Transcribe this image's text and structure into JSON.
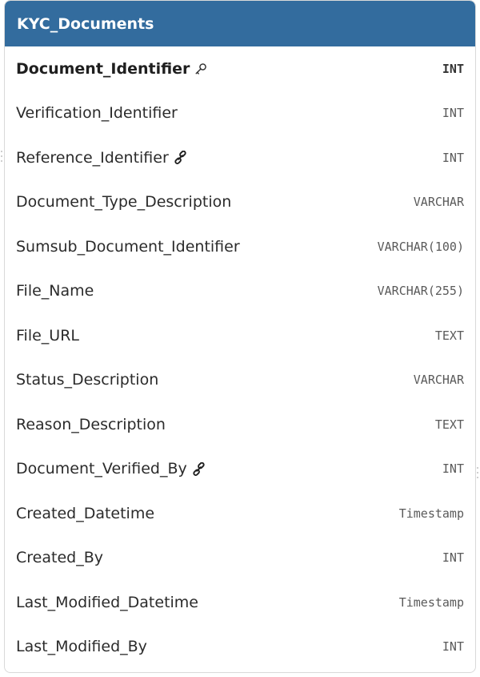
{
  "table": {
    "name": "KYC_Documents",
    "header_color": "#336c9e",
    "columns": [
      {
        "name": "Document_Identifier",
        "type": "INT",
        "icon": "key-icon",
        "primary_key": true
      },
      {
        "name": "Verification_Identifier",
        "type": "INT",
        "icon": "",
        "primary_key": false
      },
      {
        "name": "Reference_Identifier",
        "type": "INT",
        "icon": "link-icon",
        "primary_key": false
      },
      {
        "name": "Document_Type_Description",
        "type": "VARCHAR",
        "icon": "",
        "primary_key": false
      },
      {
        "name": "Sumsub_Document_Identifier",
        "type": "VARCHAR(100)",
        "icon": "",
        "primary_key": false
      },
      {
        "name": "File_Name",
        "type": "VARCHAR(255)",
        "icon": "",
        "primary_key": false
      },
      {
        "name": "File_URL",
        "type": "TEXT",
        "icon": "",
        "primary_key": false
      },
      {
        "name": "Status_Description",
        "type": "VARCHAR",
        "icon": "",
        "primary_key": false
      },
      {
        "name": "Reason_Description",
        "type": "TEXT",
        "icon": "",
        "primary_key": false
      },
      {
        "name": "Document_Verified_By",
        "type": "INT",
        "icon": "link-icon",
        "primary_key": false
      },
      {
        "name": "Created_Datetime",
        "type": "Timestamp",
        "icon": "",
        "primary_key": false
      },
      {
        "name": "Created_By",
        "type": "INT",
        "icon": "",
        "primary_key": false
      },
      {
        "name": "Last_Modified_Datetime",
        "type": "Timestamp",
        "icon": "",
        "primary_key": false
      },
      {
        "name": "Last_Modified_By",
        "type": "INT",
        "icon": "",
        "primary_key": false
      }
    ]
  }
}
